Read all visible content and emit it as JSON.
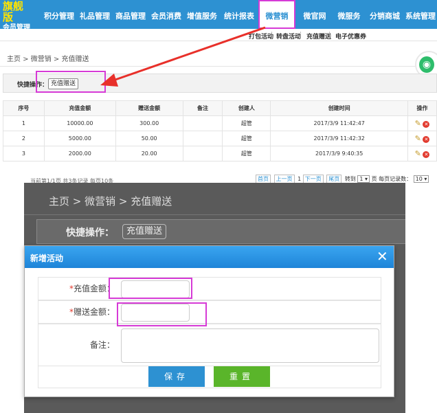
{
  "brand": {
    "title": "旗舰版",
    "subtitle": "会员管理"
  },
  "nav": {
    "items": [
      {
        "label": "积分管理"
      },
      {
        "label": "礼品管理"
      },
      {
        "label": "商品管理"
      },
      {
        "label": "会员消费"
      },
      {
        "label": "增值服务"
      },
      {
        "label": "统计报表"
      },
      {
        "label": "微营销"
      },
      {
        "label": "微官网"
      },
      {
        "label": "微服务"
      },
      {
        "label": "分销商城"
      },
      {
        "label": "系统管理"
      }
    ],
    "active": "微营销"
  },
  "subnav": {
    "items": [
      "打包活动",
      "转盘活动",
      "充值赠送",
      "电子优惠券"
    ],
    "separator": "|"
  },
  "breadcrumb": {
    "text": "主页 > 微营销 > 充值赠送"
  },
  "quick": {
    "label": "快捷操作：",
    "button": "充值赠送"
  },
  "table": {
    "headers": [
      "序号",
      "充值金额",
      "赠送金额",
      "备注",
      "创建人",
      "创建时间",
      "操作"
    ],
    "rows": [
      {
        "no": "1",
        "amount": "10000.00",
        "gift": "300.00",
        "note": "",
        "creator": "超管",
        "time": "2017/3/9 11:42:47"
      },
      {
        "no": "2",
        "amount": "5000.00",
        "gift": "50.00",
        "note": "",
        "creator": "超管",
        "time": "2017/3/9 11:42:32"
      },
      {
        "no": "3",
        "amount": "2000.00",
        "gift": "20.00",
        "note": "",
        "creator": "超管",
        "time": "2017/3/9 9:40:35"
      }
    ]
  },
  "pager": {
    "summary": "当前第1/1页 共3条记录 每页10条",
    "first": "首页",
    "prev": "上一页",
    "page": "1",
    "next": "下一页",
    "last": "尾页",
    "goto_label": "转到",
    "goto_value": "1",
    "goto_unit": "页",
    "per_page_label": "每页记录数：",
    "per_page_value": "10"
  },
  "zoom": {
    "breadcrumb": "主页 > 微营销 > 充值赠送",
    "quick_label": "快捷操作：",
    "quick_button": "充值赠送"
  },
  "modal": {
    "title": "新增活动",
    "close": "✕",
    "fields": [
      {
        "label": "充值金额：",
        "required": true,
        "value": "",
        "placeholder": ""
      },
      {
        "label": "赠送金额：",
        "required": true,
        "value": "",
        "placeholder": ""
      },
      {
        "label": "备注：",
        "required": false,
        "value": "",
        "placeholder": ""
      }
    ],
    "required_mark": "*",
    "save": "保存",
    "reset": "重置"
  },
  "colors": {
    "primary": "#2d91d2",
    "highlight": "#d63ad6",
    "arrow": "#e8302a",
    "save": "#2d91d2",
    "reset": "#5ab52a"
  },
  "icons": [
    "pencil-icon",
    "delete-icon",
    "wifi-icon",
    "close-icon",
    "arrow"
  ]
}
